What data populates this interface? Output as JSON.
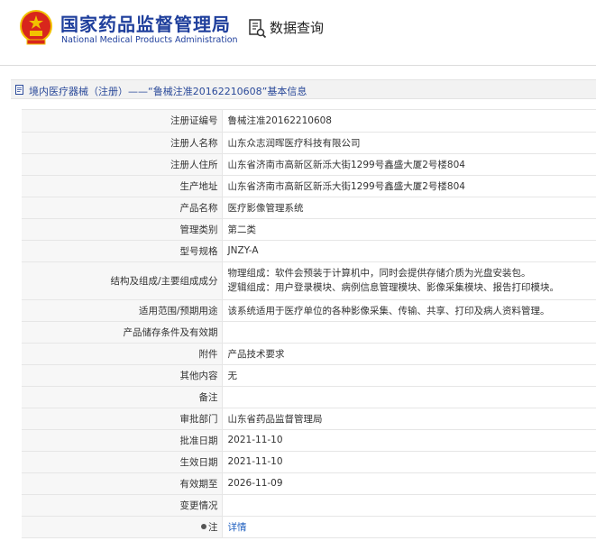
{
  "header": {
    "org_name_cn": "国家药品监督管理局",
    "org_name_en": "National Medical Products Administration",
    "query_title": "数据查询"
  },
  "breadcrumb": {
    "text": "境内医疗器械（注册）——“鲁械注准20162210608”基本信息"
  },
  "rows": [
    {
      "label": "注册证编号",
      "value": "鲁械注准20162210608"
    },
    {
      "label": "注册人名称",
      "value": "山东众志润晖医疗科技有限公司"
    },
    {
      "label": "注册人住所",
      "value": "山东省济南市高新区新泺大街1299号鑫盛大厦2号楼804"
    },
    {
      "label": "生产地址",
      "value": "山东省济南市高新区新泺大街1299号鑫盛大厦2号楼804"
    },
    {
      "label": "产品名称",
      "value": "医疗影像管理系统"
    },
    {
      "label": "管理类别",
      "value": "第二类"
    },
    {
      "label": "型号规格",
      "value": "JNZY-A"
    },
    {
      "label": "结构及组成/主要组成成分",
      "value_lines": [
        "物理组成：软件会预装于计算机中，同时会提供存储介质为光盘安装包。",
        "逻辑组成：用户登录模块、病例信息管理模块、影像采集模块、报告打印模块。"
      ]
    },
    {
      "label": "适用范围/预期用途",
      "value": "该系统适用于医疗单位的各种影像采集、传输、共享、打印及病人资料管理。"
    },
    {
      "label": "产品储存条件及有效期",
      "value": ""
    },
    {
      "label": "附件",
      "value": "产品技术要求"
    },
    {
      "label": "其他内容",
      "value": "无"
    },
    {
      "label": "备注",
      "value": ""
    },
    {
      "label": "审批部门",
      "value": "山东省药品监督管理局"
    },
    {
      "label": "批准日期",
      "value": "2021-11-10"
    },
    {
      "label": "生效日期",
      "value": "2021-11-10"
    },
    {
      "label": "有效期至",
      "value": "2026-11-09"
    },
    {
      "label": "变更情况",
      "value": ""
    },
    {
      "label": "注",
      "value": "详情"
    }
  ],
  "colors": {
    "brand_blue": "#1f3f9c",
    "emblem_red": "#d8261c",
    "emblem_gold": "#f2c200",
    "link_blue": "#1f5fbf"
  }
}
